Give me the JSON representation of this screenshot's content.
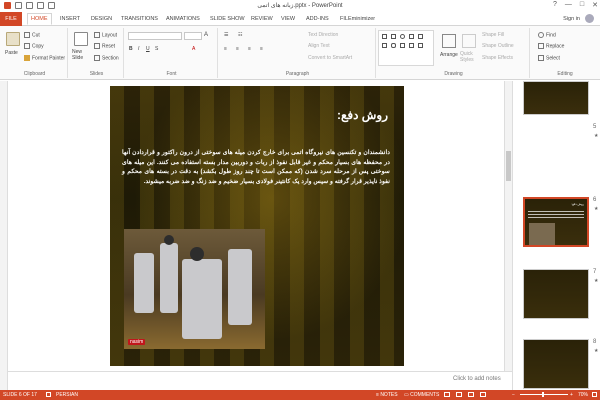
{
  "window": {
    "title": "زبانه های اتمی.pptx - PowerPoint",
    "controls": [
      "?",
      "—",
      "□",
      "✕"
    ]
  },
  "tabs": {
    "file": "FILE",
    "items": [
      "HOME",
      "INSERT",
      "DESIGN",
      "TRANSITIONS",
      "ANIMATIONS",
      "SLIDE SHOW",
      "REVIEW",
      "VIEW",
      "ADD-INS",
      "FILEminimizer"
    ],
    "active": "HOME",
    "signin": "Sign in"
  },
  "ribbon": {
    "clipboard": {
      "label": "Clipboard",
      "paste": "Paste",
      "cut": "Cut",
      "copy": "Copy",
      "format_painter": "Format Painter"
    },
    "slides": {
      "label": "Slides",
      "new_slide": "New Slide",
      "layout": "Layout",
      "reset": "Reset",
      "section": "Section"
    },
    "font": {
      "label": "Font"
    },
    "paragraph": {
      "label": "Paragraph",
      "text_direction": "Text Direction",
      "align_text": "Align Text",
      "convert_smartart": "Convert to SmartArt"
    },
    "drawing": {
      "label": "Drawing",
      "arrange": "Arrange",
      "quick_styles": "Quick Styles",
      "shape_fill": "Shape Fill",
      "shape_outline": "Shape Outline",
      "shape_effects": "Shape Effects"
    },
    "editing": {
      "label": "Editing",
      "find": "Find",
      "replace": "Replace",
      "select": "Select"
    }
  },
  "slide": {
    "title": "روش دفع:",
    "body": "دانشمندان و تکنسین های نیروگاه اتمی برای خارج کردن میله های سوختی از درون راکتور و قراردادن آنها در محفظه های بسیار محکم و غیر قابل نفوذ از ربات و دوربین مدار بسته استفاده می کنند. این میله های سوختی پس از مرحله سرد شدن (که ممکن است تا چند روز طول بکشد) به دقت در بسته های محکم و نفوذ ناپذیر قرار گرفته و سپس وارد یک کانتینر فولادی بسیار ضخیم و ضد زنگ و ضد ضربه میشوند.",
    "watermark": "nasim"
  },
  "notes": {
    "placeholder": "Click to add notes"
  },
  "thumbnails": [
    {
      "number": "5",
      "star": "★",
      "active": false,
      "title": ""
    },
    {
      "number": "6",
      "star": "★",
      "active": true,
      "title": "روش دفع:"
    },
    {
      "number": "7",
      "star": "★",
      "active": false,
      "title": ""
    },
    {
      "number": "8",
      "star": "★",
      "active": false,
      "title": ""
    }
  ],
  "status": {
    "slide": "SLIDE 6 OF 17",
    "language": "PERSIAN",
    "notes": "NOTES",
    "comments": "COMMENTS",
    "zoom": "70%"
  },
  "colors": {
    "accent": "#d24726"
  }
}
